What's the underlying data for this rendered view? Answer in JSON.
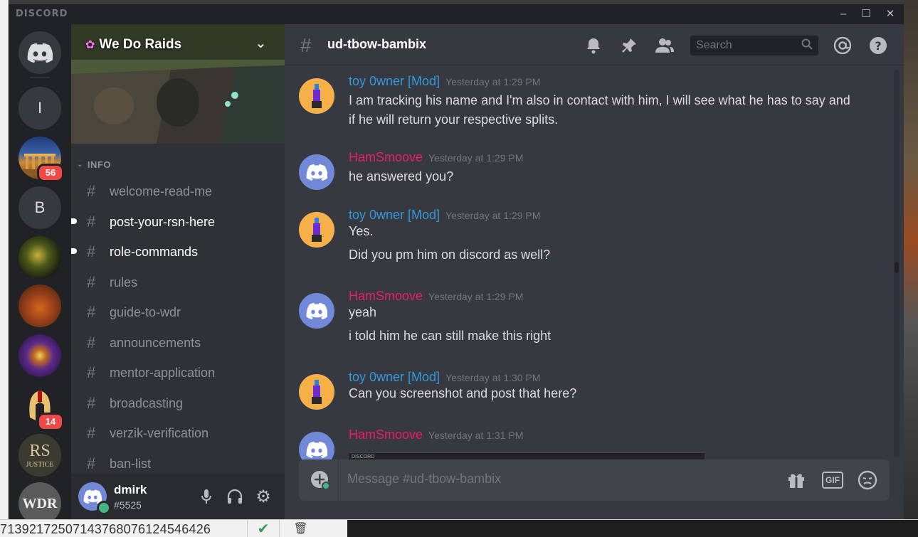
{
  "window": {
    "wordmark": "DISCORD"
  },
  "server": {
    "name": "We Do Raids"
  },
  "rail": {
    "servers": [
      {
        "letter": "I"
      },
      {
        "badge": "56"
      },
      {
        "letter": "B"
      },
      {
        "badge": "14"
      },
      {
        "text": "RS",
        "subtext": "JUSTICE"
      },
      {
        "text": "WDR"
      }
    ]
  },
  "sidebar": {
    "category": "INFO",
    "channels": [
      {
        "name": "welcome-read-me"
      },
      {
        "name": "post-your-rsn-here"
      },
      {
        "name": "role-commands"
      },
      {
        "name": "rules"
      },
      {
        "name": "guide-to-wdr"
      },
      {
        "name": "announcements"
      },
      {
        "name": "mentor-application"
      },
      {
        "name": "broadcasting"
      },
      {
        "name": "verzik-verification"
      },
      {
        "name": "ban-list"
      }
    ]
  },
  "user": {
    "name": "dmirk",
    "tag": "#5525"
  },
  "channel": {
    "name": "ud-tbow-bambix",
    "search_placeholder": "Search"
  },
  "messages": [
    {
      "author": "toy 0wner [Mod]",
      "time": "Yesterday at 1:29 PM",
      "lines": [
        "I am tracking his name and I'm also in contact with him, I will see what he has to say and",
        "if he will return your respective splits."
      ]
    },
    {
      "author": "HamSmoove",
      "time": "Yesterday at 1:29 PM",
      "lines": [
        "he answered you?"
      ]
    },
    {
      "author": "toy 0wner [Mod]",
      "time": "Yesterday at 1:29 PM",
      "lines": [
        "Yes.",
        "Did you pm him on discord as well?"
      ]
    },
    {
      "author": "HamSmoove",
      "time": "Yesterday at 1:29 PM",
      "lines": [
        "yeah",
        "i told him he can still make this right"
      ]
    },
    {
      "author": "toy 0wner [Mod]",
      "time": "Yesterday at 1:30 PM",
      "lines": [
        "Can you screenshot and post that here?"
      ]
    },
    {
      "author": "HamSmoove",
      "time": "Yesterday at 1:31 PM",
      "lines": [],
      "attachment_label": "DISCORD"
    }
  ],
  "composer": {
    "placeholder": "Message #ud-tbow-bambix",
    "gif_label": "GIF"
  },
  "background": {
    "ids_text": "7139217250714376807612454642​6"
  },
  "colors": {
    "mod": "#3498db",
    "ham": "#e91e63",
    "blurple": "#7289da",
    "badge": "#f04747",
    "online": "#43b581"
  },
  "icons": [
    "discord-home-icon",
    "bell-icon",
    "pin-icon",
    "members-icon",
    "search-icon",
    "mention-icon",
    "help-icon",
    "microphone-icon",
    "headphones-icon",
    "gear-icon",
    "plus-icon",
    "gift-icon",
    "gif-icon",
    "emoji-icon"
  ]
}
